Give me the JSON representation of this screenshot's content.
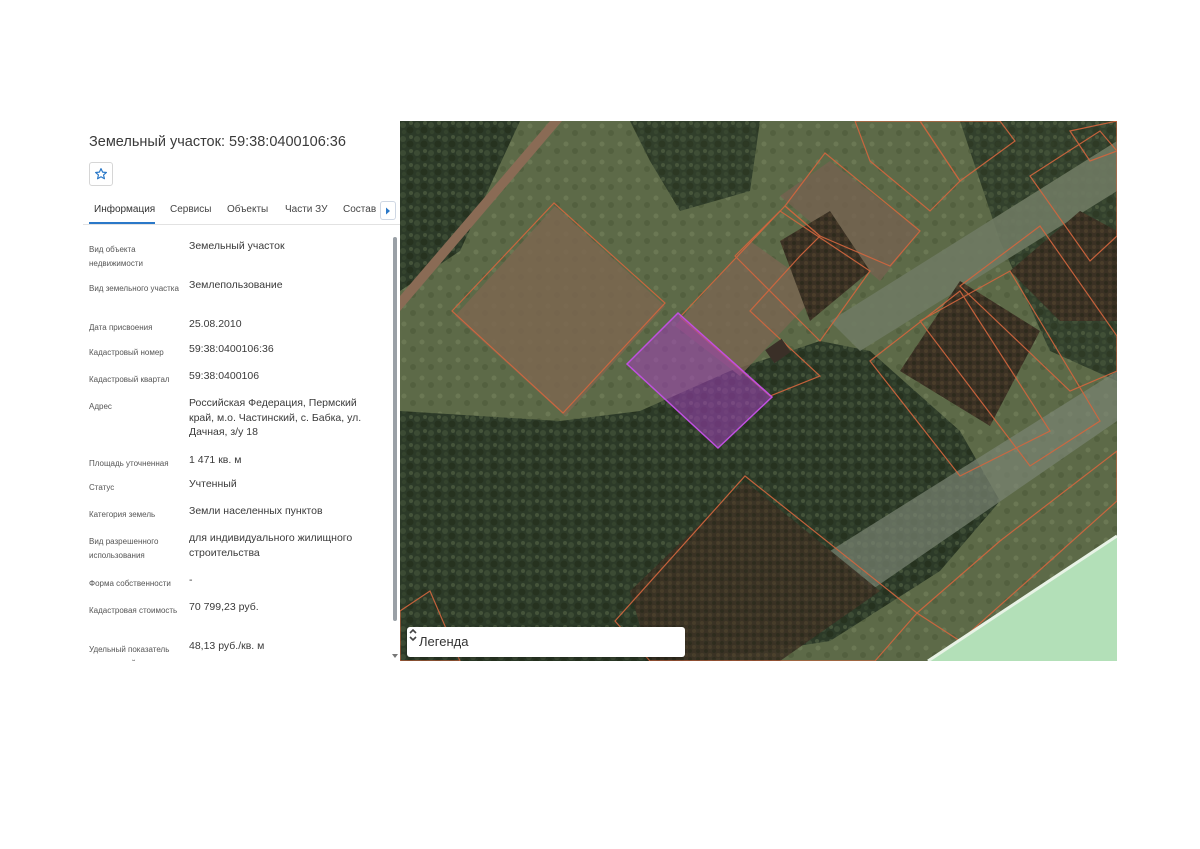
{
  "panel": {
    "title": "Земельный участок: 59:38:0400106:36",
    "star_icon": "star-outline-icon",
    "tabs": [
      {
        "label": "Информация",
        "active": true
      },
      {
        "label": "Сервисы",
        "active": false
      },
      {
        "label": "Объекты",
        "active": false
      },
      {
        "label": "Части ЗУ",
        "active": false
      },
      {
        "label": "Состав",
        "active": false
      }
    ],
    "tab_next_icon": "chevron-right-icon",
    "accent_color": "#2a78c8"
  },
  "info": [
    {
      "label": "Вид объекта недвижимости",
      "value": "Земельный участок"
    },
    {
      "label": "Вид земельного участка",
      "value": "Землепользование"
    },
    {
      "label": "Дата присвоения",
      "value": "25.08.2010"
    },
    {
      "label": "Кадастровый номер",
      "value": "59:38:0400106:36"
    },
    {
      "label": "Кадастровый квартал",
      "value": "59:38:0400106"
    },
    {
      "label": "Адрес",
      "value": "Российская Федерация, Пермский край, м.о. Частинский, с. Бабка, ул. Дачная, з/у 18"
    },
    {
      "label": "Площадь уточненная",
      "value": "1 471 кв. м"
    },
    {
      "label": "Статус",
      "value": "Учтенный"
    },
    {
      "label": "Категория земель",
      "value": "Земли населенных пунктов"
    },
    {
      "label": "Вид разрешенного использования",
      "value": "для индивидуального жилищного строительства"
    },
    {
      "label": "Форма собственности",
      "value": "-"
    },
    {
      "label": "Кадастровая стоимость",
      "value": "70 799,23 руб."
    },
    {
      "label": "Удельный показатель кадастровой",
      "value": "48,13 руб./кв. м"
    }
  ],
  "map": {
    "legend_label": "Легенда",
    "legend_icon": "chevron-updown-icon",
    "parcel_border_color": "#d4663e",
    "selected_parcel_color": "#b04ac8",
    "water_color": "#b3e0b8"
  }
}
